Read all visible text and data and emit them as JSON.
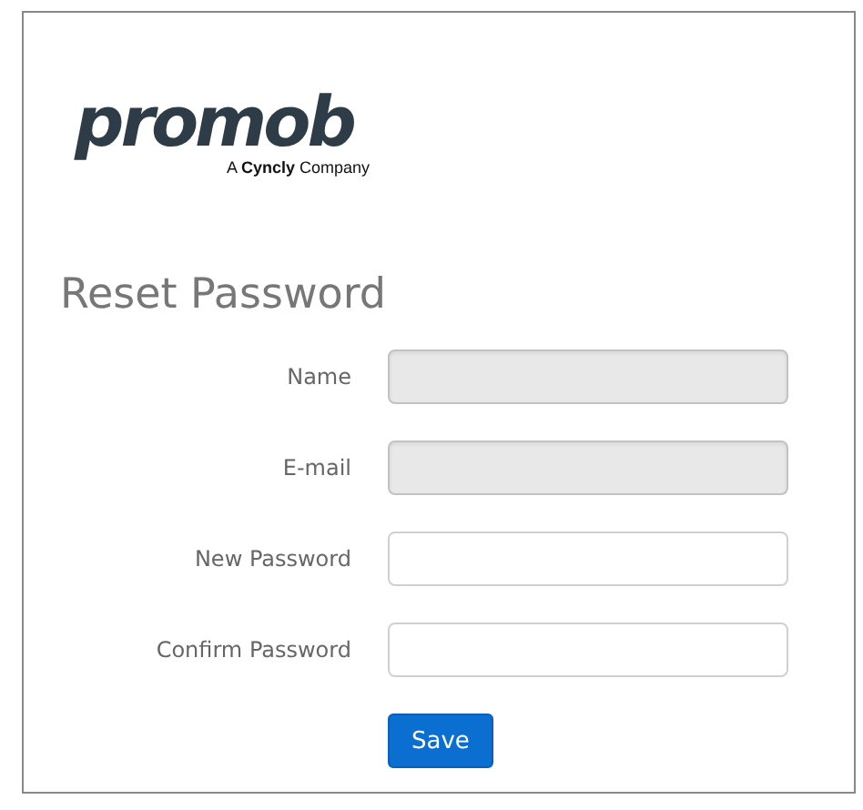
{
  "logo": {
    "wordmark": "promob",
    "tagline": "A **Cyncly** Company"
  },
  "title": "Reset Password",
  "fields": [
    {
      "label": "Name",
      "disabled": true
    },
    {
      "label": "E-mail",
      "disabled": true
    },
    {
      "label": "New Password",
      "disabled": false
    },
    {
      "label": "Confirm Password",
      "disabled": false
    }
  ],
  "buttons": [
    "Save"
  ]
}
